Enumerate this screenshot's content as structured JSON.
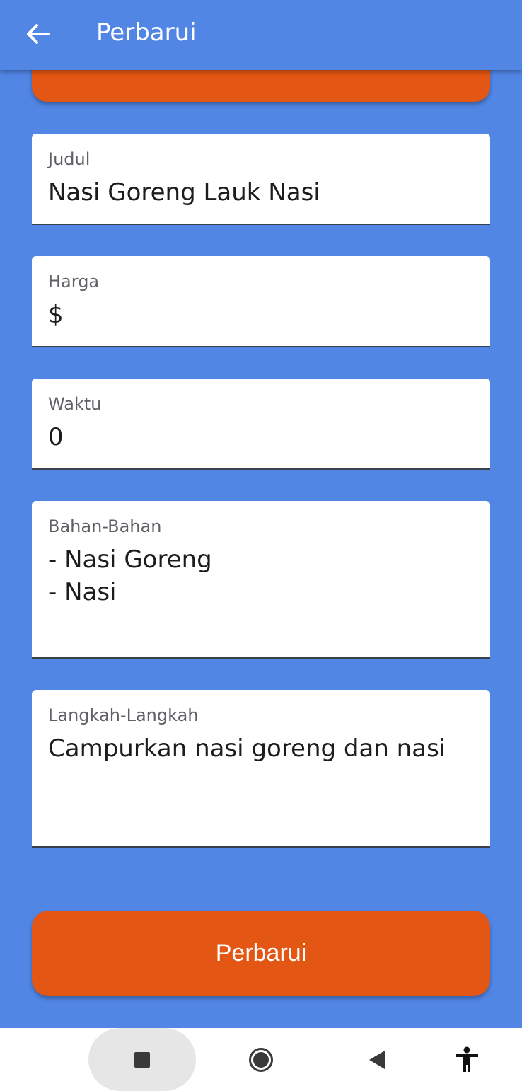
{
  "app_bar": {
    "title": "Perbarui",
    "back_icon": "arrow-left-icon"
  },
  "form": {
    "judul": {
      "label": "Judul",
      "value": "Nasi Goreng Lauk Nasi"
    },
    "harga": {
      "label": "Harga",
      "value": "$"
    },
    "waktu": {
      "label": "Waktu",
      "value": "0"
    },
    "bahan": {
      "label": "Bahan-Bahan",
      "value": "- Nasi Goreng\n- Nasi"
    },
    "langkah": {
      "label": "Langkah-Langkah",
      "value": "Campurkan nasi goreng dan nasi"
    }
  },
  "submit_button": {
    "label": "Perbarui"
  },
  "nav_bar": {
    "recent_icon": "square-icon",
    "home_icon": "circle-icon",
    "back_icon": "triangle-back-icon",
    "accessibility_icon": "accessibility-icon"
  },
  "colors": {
    "background": "#5186e5",
    "accent": "#e35613",
    "field_bg": "#ffffff"
  }
}
